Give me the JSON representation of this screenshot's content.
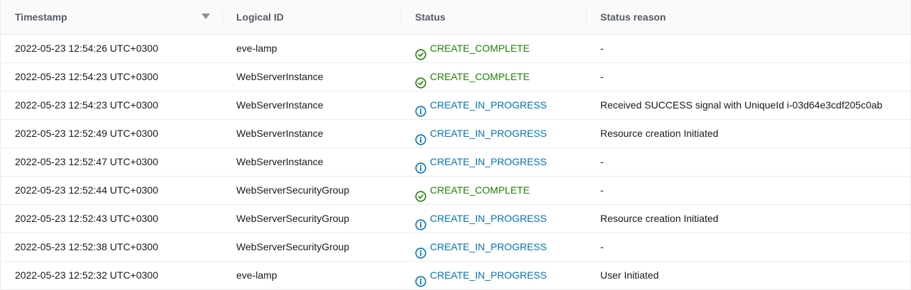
{
  "header": {
    "timestamp": "Timestamp",
    "logical_id": "Logical ID",
    "status": "Status",
    "status_reason": "Status reason"
  },
  "rows": [
    {
      "timestamp": "2022-05-23 12:54:26 UTC+0300",
      "logical_id": "eve-lamp",
      "status": "CREATE_COMPLETE",
      "status_type": "complete",
      "reason": "-"
    },
    {
      "timestamp": "2022-05-23 12:54:23 UTC+0300",
      "logical_id": "WebServerInstance",
      "status": "CREATE_COMPLETE",
      "status_type": "complete",
      "reason": "-"
    },
    {
      "timestamp": "2022-05-23 12:54:23 UTC+0300",
      "logical_id": "WebServerInstance",
      "status": "CREATE_IN_PROGRESS",
      "status_type": "progress",
      "reason": "Received SUCCESS signal with UniqueId i-03d64e3cdf205c0ab"
    },
    {
      "timestamp": "2022-05-23 12:52:49 UTC+0300",
      "logical_id": "WebServerInstance",
      "status": "CREATE_IN_PROGRESS",
      "status_type": "progress",
      "reason": "Resource creation Initiated"
    },
    {
      "timestamp": "2022-05-23 12:52:47 UTC+0300",
      "logical_id": "WebServerInstance",
      "status": "CREATE_IN_PROGRESS",
      "status_type": "progress",
      "reason": "-"
    },
    {
      "timestamp": "2022-05-23 12:52:44 UTC+0300",
      "logical_id": "WebServerSecurityGroup",
      "status": "CREATE_COMPLETE",
      "status_type": "complete",
      "reason": "-"
    },
    {
      "timestamp": "2022-05-23 12:52:43 UTC+0300",
      "logical_id": "WebServerSecurityGroup",
      "status": "CREATE_IN_PROGRESS",
      "status_type": "progress",
      "reason": "Resource creation Initiated"
    },
    {
      "timestamp": "2022-05-23 12:52:38 UTC+0300",
      "logical_id": "WebServerSecurityGroup",
      "status": "CREATE_IN_PROGRESS",
      "status_type": "progress",
      "reason": "-"
    },
    {
      "timestamp": "2022-05-23 12:52:32 UTC+0300",
      "logical_id": "eve-lamp",
      "status": "CREATE_IN_PROGRESS",
      "status_type": "progress",
      "reason": "User Initiated"
    }
  ],
  "colors": {
    "complete": "#1d8102",
    "progress": "#0073bb"
  },
  "icons": {
    "complete": "check-circle-icon",
    "progress": "info-circle-icon"
  }
}
